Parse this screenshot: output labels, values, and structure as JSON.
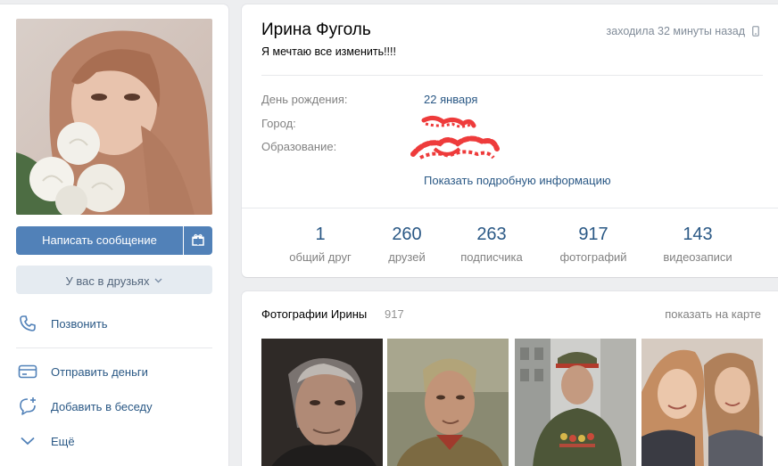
{
  "left": {
    "message_button": "Написать сообщение",
    "friends_button": "У вас в друзьях",
    "actions": [
      {
        "label": "Позвонить",
        "icon": "phone-icon"
      },
      {
        "label": "Отправить деньги",
        "icon": "card-icon"
      },
      {
        "label": "Добавить в беседу",
        "icon": "chat-add-icon"
      },
      {
        "label": "Ещё",
        "icon": "chevron-down-icon"
      }
    ]
  },
  "profile": {
    "name": "Ирина Фуголь",
    "last_seen": "заходила 32 минуты назад",
    "status": "Я мечтаю все изменить!!!!",
    "info": [
      {
        "label": "День рождения:",
        "value": "22 января"
      },
      {
        "label": "Город:",
        "value": ""
      },
      {
        "label": "Образование:",
        "value": ""
      }
    ],
    "more_info_link": "Показать подробную информацию",
    "counters": [
      {
        "num": "1",
        "label": "общий друг"
      },
      {
        "num": "260",
        "label": "друзей"
      },
      {
        "num": "263",
        "label": "подписчика"
      },
      {
        "num": "917",
        "label": "фотографий"
      },
      {
        "num": "143",
        "label": "видеозаписи"
      }
    ]
  },
  "photos": {
    "title": "Фотографии Ирины",
    "count": "917",
    "show_on_map": "показать на карте"
  },
  "colors": {
    "accent": "#5181b8",
    "link": "#2a5885",
    "muted": "#828282"
  }
}
